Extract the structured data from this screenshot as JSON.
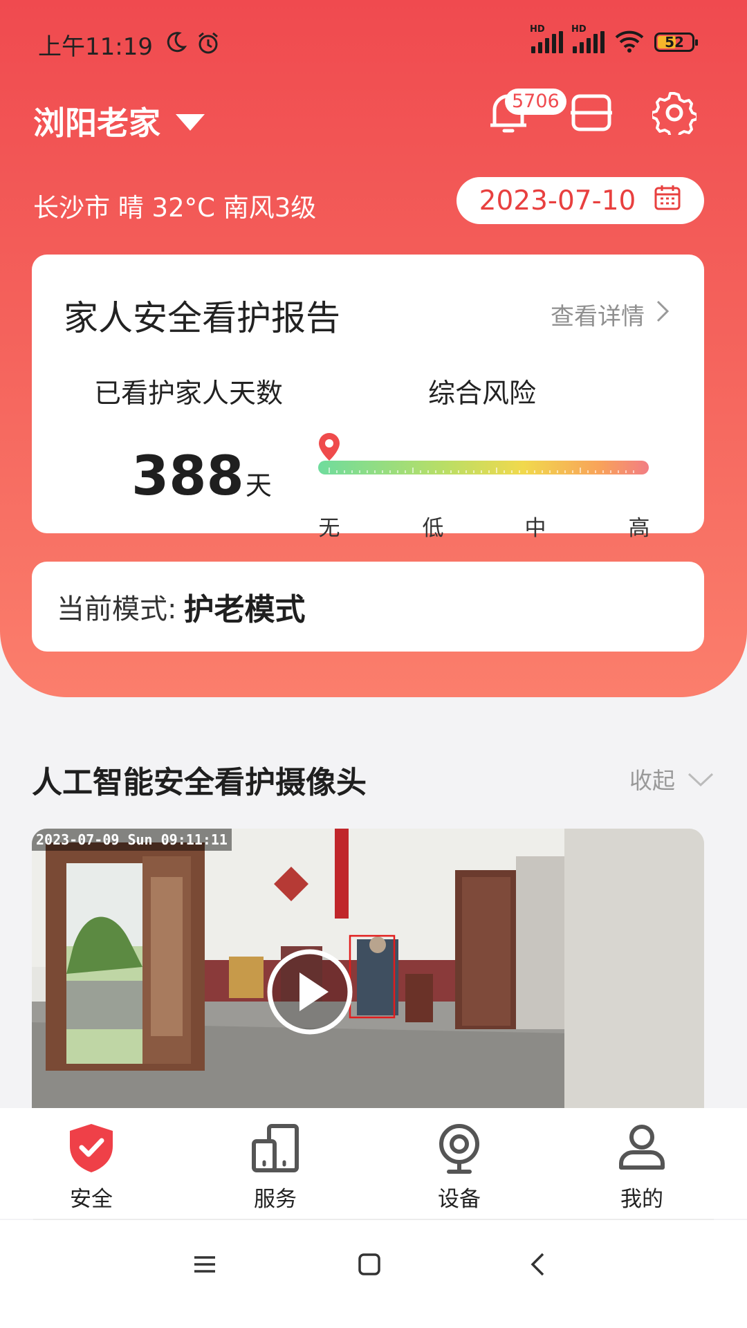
{
  "status_bar": {
    "time": "上午11:19",
    "icons": [
      "moon-icon",
      "alarm-icon"
    ],
    "right_icons": [
      "hd-signal-icon",
      "hd-signal-icon",
      "wifi-icon"
    ],
    "battery": "52"
  },
  "header": {
    "location": "浏阳老家",
    "notification_count": "5706",
    "weather": "长沙市 晴 32°C 南风3级",
    "date": "2023-07-10"
  },
  "report": {
    "title": "家人安全看护报告",
    "detail_link": "查看详情",
    "days_label": "已看护家人天数",
    "days_value": "388",
    "days_unit": "天",
    "risk_label": "综合风险",
    "risk_levels": [
      "无",
      "低",
      "中",
      "高"
    ],
    "risk_level_value": 0
  },
  "mode": {
    "label": "当前模式:",
    "value": "护老模式"
  },
  "camera": {
    "title": "人工智能安全看护摄像头",
    "collapse_label": "收起",
    "timestamp": "2023-07-09 Sun 09:11:11"
  },
  "bottom_nav": [
    {
      "label": "安全",
      "icon": "shield-check-icon",
      "active": true
    },
    {
      "label": "服务",
      "icon": "devices-icon",
      "active": false
    },
    {
      "label": "设备",
      "icon": "camera-icon",
      "active": false
    },
    {
      "label": "我的",
      "icon": "user-icon",
      "active": false
    }
  ],
  "colors": {
    "primary_red": "#f04a4f",
    "accent_red": "#e8403f"
  }
}
